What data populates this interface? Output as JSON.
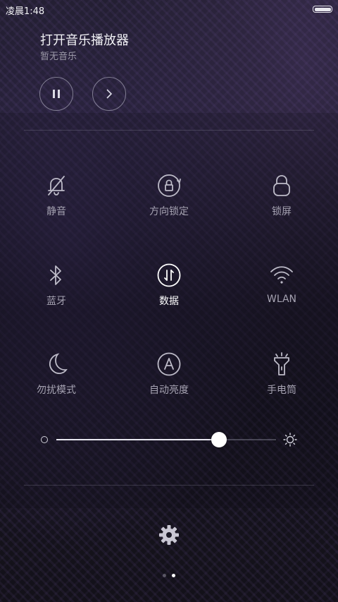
{
  "status_bar": {
    "time": "凌晨1:48"
  },
  "music": {
    "title": "打开音乐播放器",
    "subtitle": "暂无音乐",
    "pause_icon": "pause-icon",
    "next_icon": "chevron-right-icon"
  },
  "toggles": [
    {
      "label": "静音",
      "icon": "bell-off-icon",
      "active": false
    },
    {
      "label": "方向锁定",
      "icon": "rotation-lock-icon",
      "active": false
    },
    {
      "label": "锁屏",
      "icon": "lock-icon",
      "active": false
    },
    {
      "label": "蓝牙",
      "icon": "bluetooth-icon",
      "active": false
    },
    {
      "label": "数据",
      "icon": "mobile-data-icon",
      "active": true
    },
    {
      "label": "WLAN",
      "icon": "wifi-icon",
      "active": false
    },
    {
      "label": "勿扰模式",
      "icon": "moon-icon",
      "active": false
    },
    {
      "label": "自动亮度",
      "icon": "auto-brightness-icon",
      "active": false
    },
    {
      "label": "手电筒",
      "icon": "flashlight-icon",
      "active": false
    }
  ],
  "brightness": {
    "level": 0.74,
    "low_icon": "brightness-low-icon",
    "high_icon": "sun-icon"
  },
  "settings": {
    "icon": "gear-icon"
  },
  "pager": {
    "pages": 2,
    "current": 2
  },
  "colors": {
    "active_text": "#ffffff",
    "inactive_text": "#a6a3b2",
    "background": "#17151f"
  }
}
